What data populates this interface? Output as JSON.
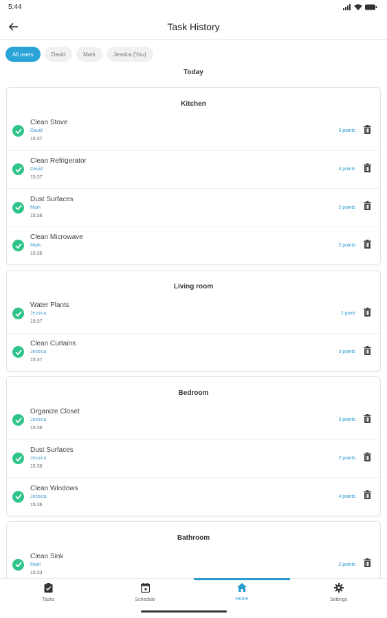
{
  "status": {
    "time": "5:44"
  },
  "header": {
    "title": "Task History"
  },
  "filters": [
    {
      "label": "All users",
      "active": true
    },
    {
      "label": "David",
      "active": false
    },
    {
      "label": "Mark",
      "active": false
    },
    {
      "label": "Jessica (You)",
      "active": false
    }
  ],
  "day": "Today",
  "rooms": [
    {
      "name": "Kitchen",
      "tasks": [
        {
          "name": "Clean Stove",
          "user": "David",
          "time": "15:37",
          "points": "3 points"
        },
        {
          "name": "Clean Refrigerator",
          "user": "David",
          "time": "15:37",
          "points": "4 points"
        },
        {
          "name": "Dust Surfaces",
          "user": "Mark",
          "time": "15:36",
          "points": "2 points"
        },
        {
          "name": "Clean Microwave",
          "user": "Mark",
          "time": "15:36",
          "points": "2 points"
        }
      ]
    },
    {
      "name": "Living room",
      "tasks": [
        {
          "name": "Water Plants",
          "user": "Jessica",
          "time": "15:37",
          "points": "1 point"
        },
        {
          "name": "Clean Curtains",
          "user": "Jessica",
          "time": "15:37",
          "points": "3 points"
        }
      ]
    },
    {
      "name": "Bedroom",
      "tasks": [
        {
          "name": "Organize Closet",
          "user": "Jessica",
          "time": "15:36",
          "points": "3 points"
        },
        {
          "name": "Dust Surfaces",
          "user": "Jessica",
          "time": "15:36",
          "points": "2 points"
        },
        {
          "name": "Clean Windows",
          "user": "Jessica",
          "time": "15:36",
          "points": "4 points"
        }
      ]
    },
    {
      "name": "Bathroom",
      "tasks": [
        {
          "name": "Clean Sink",
          "user": "Mark",
          "time": "15:33",
          "points": "2 points"
        }
      ]
    }
  ],
  "nav": [
    {
      "label": "Tasks",
      "icon": "clipboard-check-icon",
      "active": false
    },
    {
      "label": "Schedule",
      "icon": "calendar-icon",
      "active": false
    },
    {
      "label": "Home",
      "icon": "home-icon",
      "active": true
    },
    {
      "label": "Settings",
      "icon": "gear-icon",
      "active": false
    }
  ],
  "colors": {
    "accent": "#2aa3d9",
    "check": "#2ec48a"
  }
}
